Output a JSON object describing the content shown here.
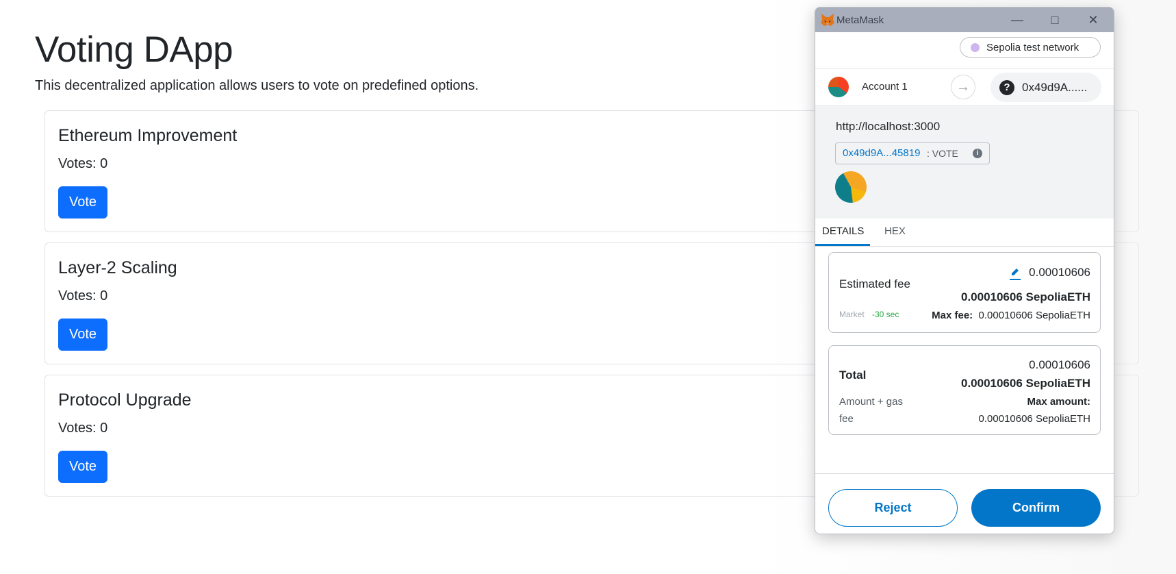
{
  "page": {
    "title": "Voting DApp",
    "description": "This decentralized application allows users to vote on predefined options."
  },
  "proposals": [
    {
      "name": "Ethereum Improvement",
      "votes": "Votes: 0",
      "button": "Vote"
    },
    {
      "name": "Layer-2 Scaling",
      "votes": "Votes: 0",
      "button": "Vote"
    },
    {
      "name": "Protocol Upgrade",
      "votes": "Votes: 0",
      "button": "Vote"
    }
  ],
  "metamask": {
    "window_title": "MetaMask",
    "network": "Sepolia test network",
    "account": "Account 1",
    "recipient": "0x49d9A......",
    "origin": "http://localhost:3000",
    "contract_address": "0x49d9A...45819",
    "method": ": VOTE",
    "info_icon": "i",
    "tabs": [
      "DETAILS",
      "HEX"
    ],
    "fee": {
      "label": "Estimated fee",
      "value": "0.00010606",
      "value_eth": "0.00010606 SepoliaETH",
      "market": "Market",
      "time": "-30 sec",
      "max_fee_label": "Max fee:",
      "max_fee_value": "0.00010606 SepoliaETH"
    },
    "total": {
      "label": "Total",
      "value": "0.00010606",
      "value_eth": "0.00010606 SepoliaETH",
      "amount_gas_line1": "Amount + gas",
      "amount_gas_line2": "fee",
      "max_amount_label": "Max amount:",
      "max_amount_value": "0.00010606 SepoliaETH"
    },
    "buttons": {
      "reject": "Reject",
      "confirm": "Confirm"
    },
    "colors": {
      "primary": "#0376c9",
      "success": "#28a745",
      "dapp_button": "#0d6efd"
    }
  }
}
